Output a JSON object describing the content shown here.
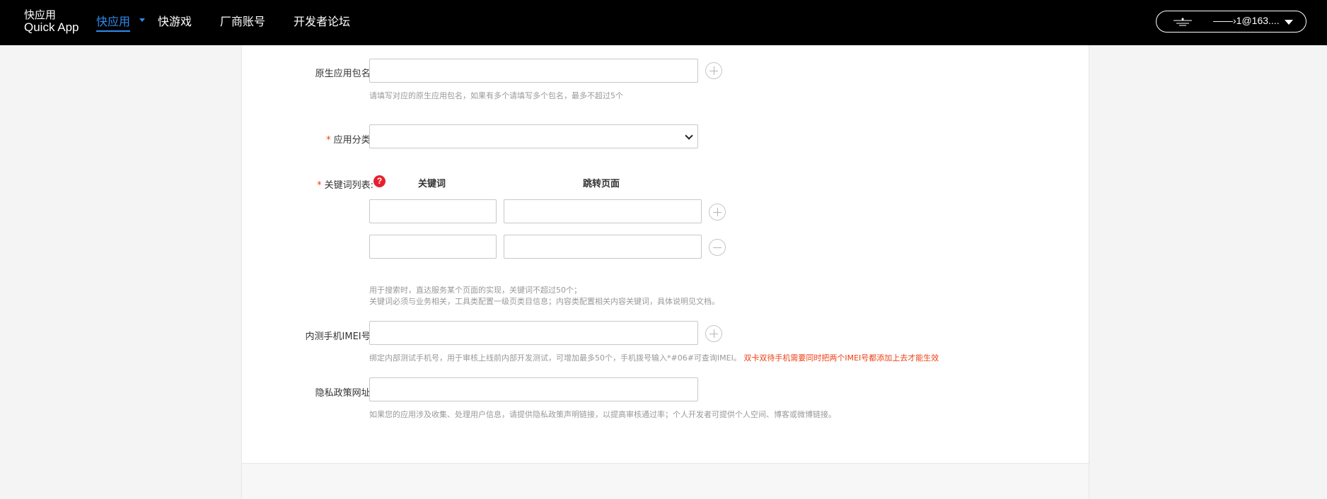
{
  "header": {
    "logo_line1": "快应用",
    "logo_line2": "Quick App",
    "nav": {
      "quickapp": "快应用",
      "quickgame": "快游戏",
      "vendor_account": "厂商账号",
      "forum": "开发者论坛"
    },
    "account_email": "——›1@163...."
  },
  "form": {
    "native_pkg": {
      "label": "原生应用包名:",
      "help": "请填写对应的原生应用包名，如果有多个请填写多个包名，最多不超过5个"
    },
    "category": {
      "required_mark": "*",
      "label": "应用分类:",
      "selected": ""
    },
    "keywords": {
      "required_mark": "*",
      "label": "关键词列表:",
      "help_icon": "?",
      "col_keyword": "关键词",
      "col_page": "跳转页面",
      "help_line1": "用于搜索时，直达服务某个页面的实现，关键词不超过50个；",
      "help_line2": "关键词必须与业务相关，工具类配置一级页类目信息；内容类配置相关内容关键词，具体说明见文档。"
    },
    "imei": {
      "label": "内测手机IMEI号:",
      "help": "绑定内部测试手机号，用于审核上线前内部开发测试，可增加最多50个，手机拨号输入*#06#可查询IMEI。",
      "warning": "双卡双待手机需要同时把两个IMEI号都添加上去才能生效"
    },
    "privacy": {
      "label": "隐私政策网址:",
      "help": "如果您的应用涉及收集、处理用户信息，请提供隐私政策声明链接，以提高审核通过率；个人开发者可提供个人空间、博客或微博链接。"
    }
  },
  "icons": {
    "add": "plus-circle-icon",
    "remove": "minus-circle-icon",
    "help": "question-icon",
    "caret": "chevron-down-icon"
  }
}
